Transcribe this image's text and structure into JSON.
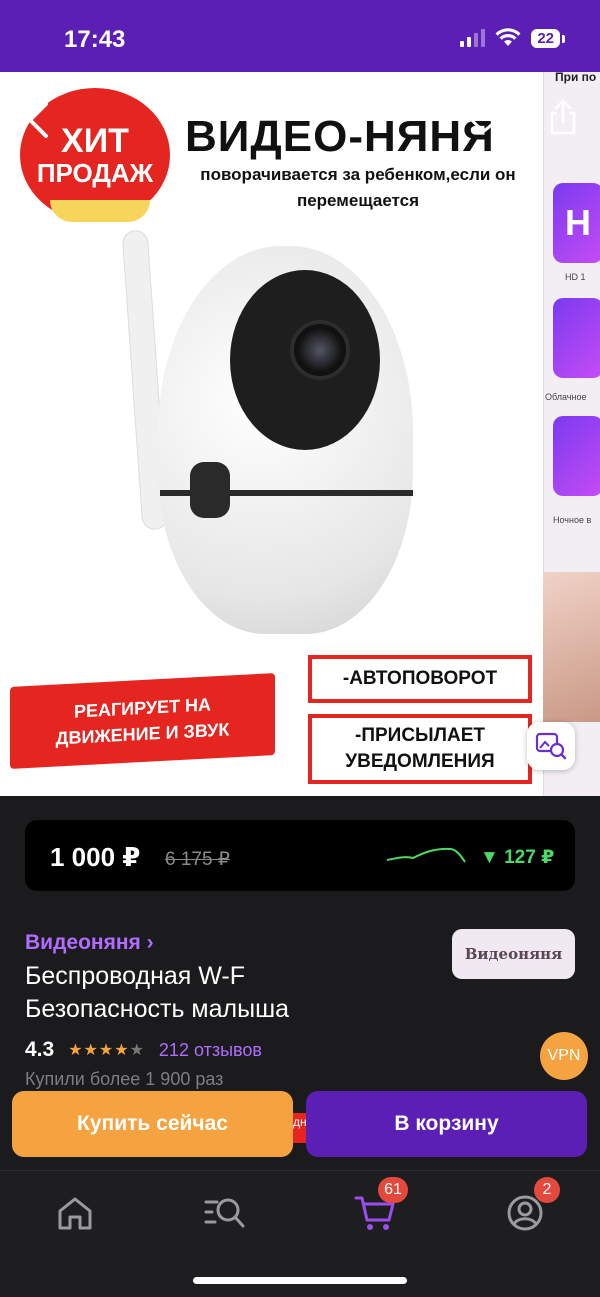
{
  "status_bar": {
    "time": "17:43",
    "battery": "22"
  },
  "poster": {
    "badge_line1": "ХИТ",
    "badge_line2": "ПРОДАЖ",
    "title": "ВИДЕО-НЯНЯ",
    "subtitle": "поворачивается за ребенком,если он перемещается",
    "banner_line1": "РЕАГИРУЕТ НА",
    "banner_line2": "ДВИЖЕНИЕ И ЗВУК",
    "box1": "-АВТОПОВОРОТ",
    "box2_line1": "-ПРИСЫЛАЕТ",
    "box2_line2": "УВЕДОМЛЕНИЯ"
  },
  "side_thumb": {
    "label": "При по",
    "tile1_letter": "H",
    "tile1_caption": "HD 1",
    "tile2_caption": "Облачное",
    "tile3_caption": "Ночное в"
  },
  "price": {
    "current": "1 000 ₽",
    "old": "6 175 ₽",
    "drop": "▼ 127 ₽",
    "drop_color": "#4cd964"
  },
  "product": {
    "category": "Видеоняня ›",
    "title_line1": "Беспроводная W-F",
    "title_line2": "Безопасность малыша",
    "brand": "Видеоняня",
    "rating": "4.3",
    "reviews": "212 отзывов",
    "bought": "Купили более 1 900 раз",
    "vpn": "VPN"
  },
  "actions": {
    "buy_now": "Купить сейчас",
    "add_to_cart": "В корзину",
    "peek_text": "дн"
  },
  "tab_bar": {
    "cart_badge": "61",
    "profile_badge": "2",
    "accent": "#5b1fb5"
  },
  "icons": [
    "back-icon",
    "heart-icon",
    "share-icon",
    "image-search-icon",
    "home-icon",
    "catalog-search-icon",
    "cart-icon",
    "profile-icon"
  ]
}
